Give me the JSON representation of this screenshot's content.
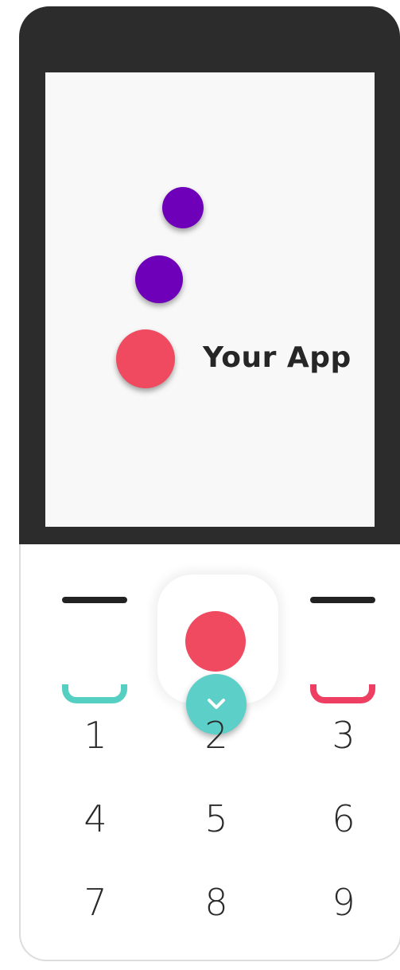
{
  "screen": {
    "app_label": "Your App",
    "colors": {
      "purple_dot": "#6d00b8",
      "red_dot": "#ef4a5f",
      "screen_bg": "#f8f8f8",
      "bezel": "#2c2c2c"
    }
  },
  "keypad": {
    "softkeys": {
      "left_icon": "softkey-dash-icon",
      "right_icon": "softkey-dash-icon"
    },
    "call_keys": {
      "call_color": "#56cfc3",
      "end_color": "#ee3f62"
    },
    "dpad": {
      "select_color": "#ef4a5f",
      "down_icon": "chevron-down-icon",
      "down_color": "#5ccfc8"
    },
    "digits": [
      "1",
      "2",
      "3",
      "4",
      "5",
      "6",
      "7",
      "8",
      "9"
    ]
  }
}
